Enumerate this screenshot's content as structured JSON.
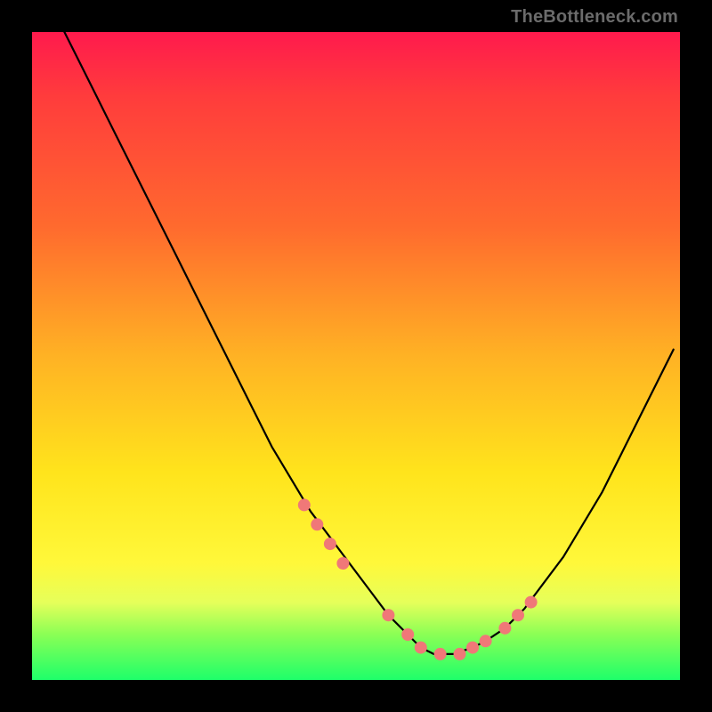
{
  "attribution": "TheBottleneck.com",
  "gradient": {
    "top": "#ff1a4d",
    "upper_mid": "#ffb224",
    "lower_mid": "#fff83a",
    "bottom": "#1eff6a"
  },
  "curve_color": "#000000",
  "marker_color": "#f07878",
  "chart_data": {
    "type": "line",
    "title": "",
    "xlabel": "",
    "ylabel": "",
    "xlim": [
      0,
      100
    ],
    "ylim": [
      0,
      100
    ],
    "grid": false,
    "series": [
      {
        "name": "bottleneck-curve",
        "x": [
          5,
          7,
          10,
          13,
          16,
          19,
          22,
          25,
          28,
          31,
          34,
          37,
          40,
          43,
          46,
          49,
          52,
          55,
          58,
          60,
          62,
          65,
          68,
          70,
          73,
          76,
          79,
          82,
          85,
          88,
          91,
          94,
          97,
          99
        ],
        "y": [
          100,
          96,
          90,
          84,
          78,
          72,
          66,
          60,
          54,
          48,
          42,
          36,
          31,
          26,
          22,
          18,
          14,
          10,
          7,
          5,
          4,
          4,
          5,
          6,
          8,
          11,
          15,
          19,
          24,
          29,
          35,
          41,
          47,
          51
        ]
      }
    ],
    "markers": {
      "name": "highlighted-points",
      "x": [
        42,
        44,
        46,
        48,
        55,
        58,
        60,
        63,
        66,
        68,
        70,
        73,
        75,
        77
      ],
      "y": [
        27,
        24,
        21,
        18,
        10,
        7,
        5,
        4,
        4,
        5,
        6,
        8,
        10,
        12
      ]
    }
  }
}
